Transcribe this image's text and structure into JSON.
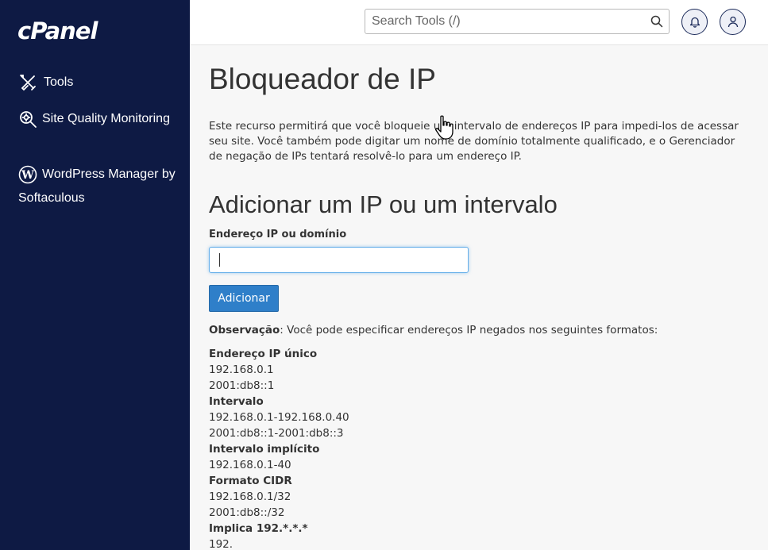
{
  "sidebar": {
    "logo": "cPanel",
    "items": [
      {
        "label": "Tools",
        "icon": "tools-icon"
      },
      {
        "label": "Site Quality Monitoring",
        "icon": "magnifier-gear-icon"
      },
      {
        "label": "WordPress Manager by Softaculous",
        "icon": "wordpress-icon"
      }
    ]
  },
  "header": {
    "search_placeholder": "Search Tools (/)",
    "icons": [
      "search-icon",
      "bell-icon",
      "user-icon"
    ]
  },
  "main": {
    "title": "Bloqueador de IP",
    "description": "Este recurso permitirá que você bloqueie um intervalo de endereços IP para impedi-los de acessar seu site. Você também pode digitar um nome de domínio totalmente qualificado, e o Gerenciador de negação de IPs tentará resolvê-lo para um endereço IP.",
    "add_section_title": "Adicionar um IP ou um intervalo",
    "field_label": "Endereço IP ou domínio",
    "field_value": "",
    "add_button": "Adicionar",
    "note_label": "Observação",
    "note_text": ": Você pode especificar endereços IP negados nos seguintes formatos:",
    "formats": [
      {
        "heading": "Endereço IP único",
        "examples": [
          "192.168.0.1",
          "2001:db8::1"
        ]
      },
      {
        "heading": "Intervalo",
        "examples": [
          "192.168.0.1-192.168.0.40",
          "2001:db8::1-2001:db8::3"
        ]
      },
      {
        "heading": "Intervalo implícito",
        "examples": [
          "192.168.0.1-40"
        ]
      },
      {
        "heading": "Formato CIDR",
        "examples": [
          "192.168.0.1/32",
          "2001:db8::/32"
        ]
      },
      {
        "heading": "Implica 192.*.*.*",
        "examples": [
          "192."
        ]
      }
    ]
  },
  "colors": {
    "sidebar_bg": "#0e1a44",
    "accent": "#2f7fc9",
    "focus_border": "#66afe9"
  }
}
